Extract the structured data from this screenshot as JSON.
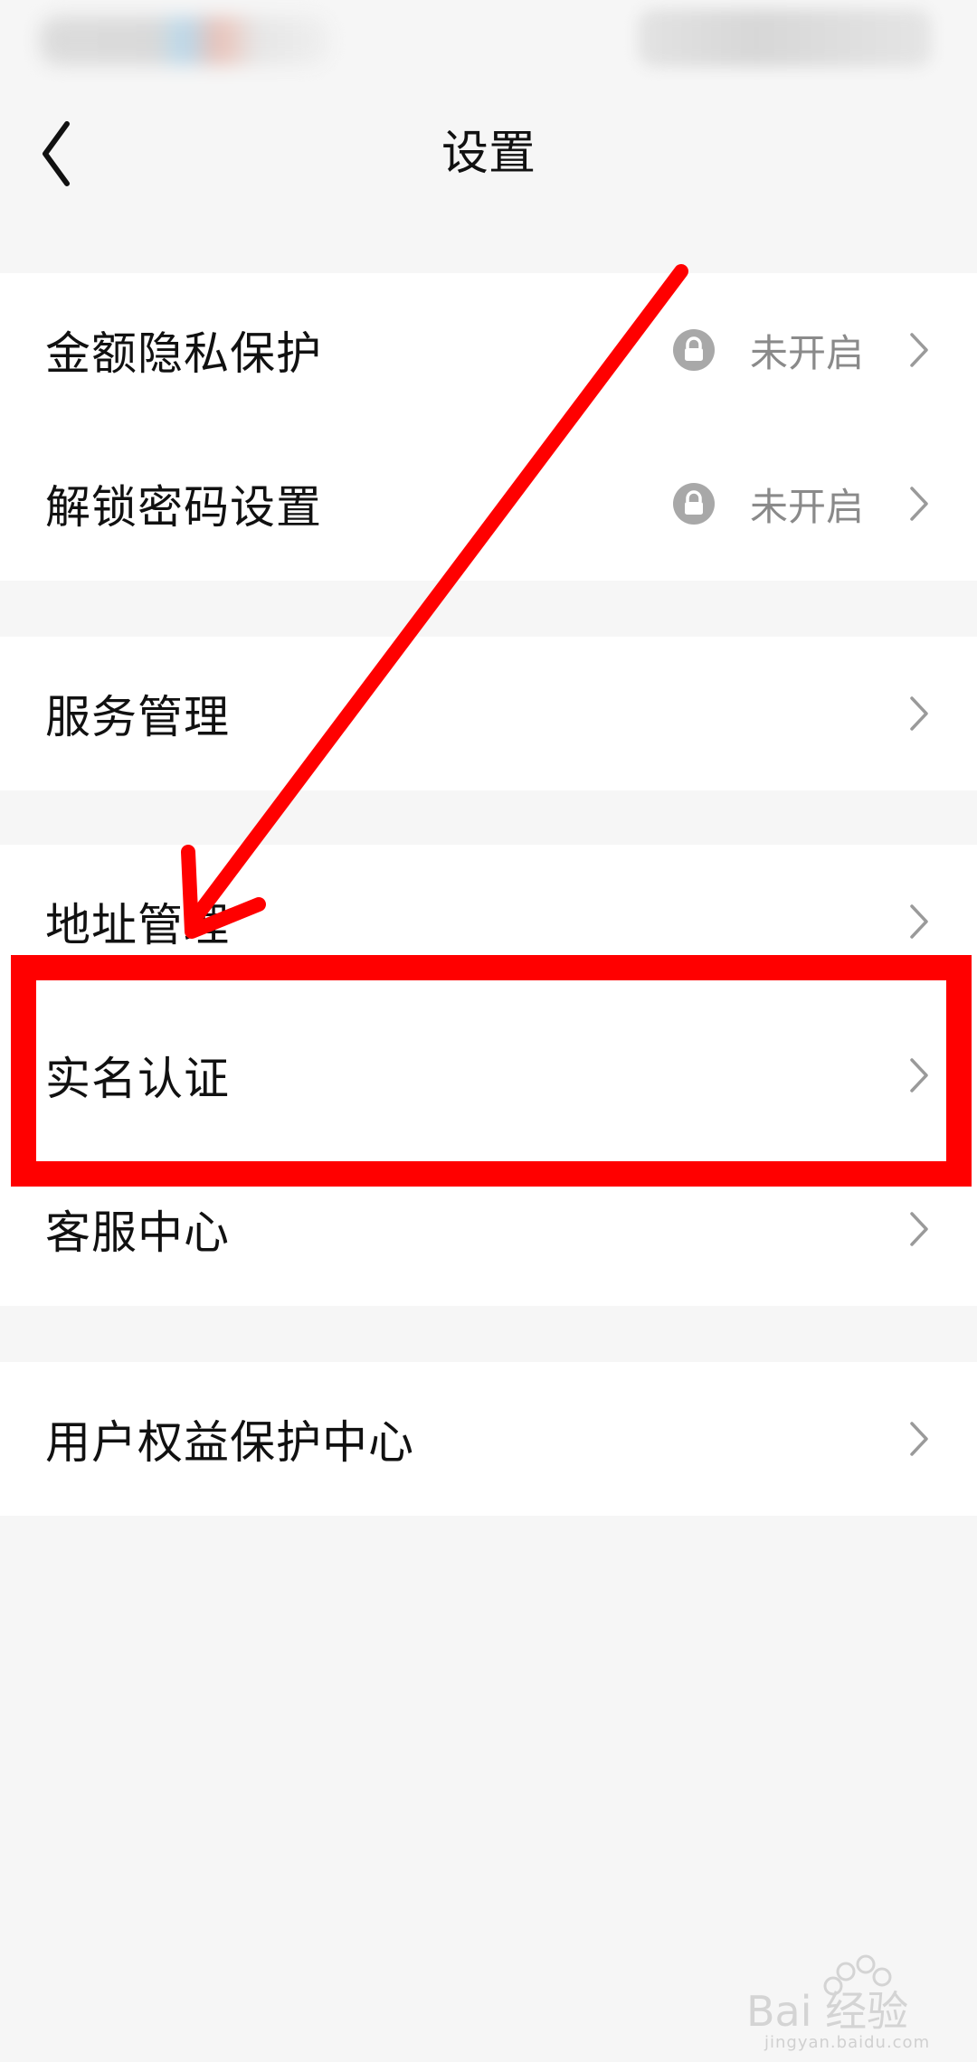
{
  "header": {
    "title": "设置",
    "back_icon": "chevron-left-icon"
  },
  "groups": [
    {
      "items": [
        {
          "label": "金额隐私保护",
          "status": "未开启",
          "status_icon": "lock-icon"
        },
        {
          "label": "解锁密码设置",
          "status": "未开启",
          "status_icon": "lock-icon"
        }
      ]
    },
    {
      "items": [
        {
          "label": "服务管理"
        }
      ]
    },
    {
      "items": [
        {
          "label": "地址管理"
        },
        {
          "label": "实名认证"
        },
        {
          "label": "客服中心"
        }
      ]
    },
    {
      "items": [
        {
          "label": "用户权益保护中心"
        }
      ]
    }
  ],
  "annotation": {
    "highlight_color": "#ff0000",
    "highlighted_item": "实名认证"
  },
  "watermark": {
    "logo_text": "Bai 经验",
    "url_text": "jingyan.baidu.com"
  },
  "colors": {
    "background": "#f6f6f6",
    "row_background": "#ffffff",
    "status_text": "#8a8a8a",
    "chevron": "#9a9a9a"
  }
}
